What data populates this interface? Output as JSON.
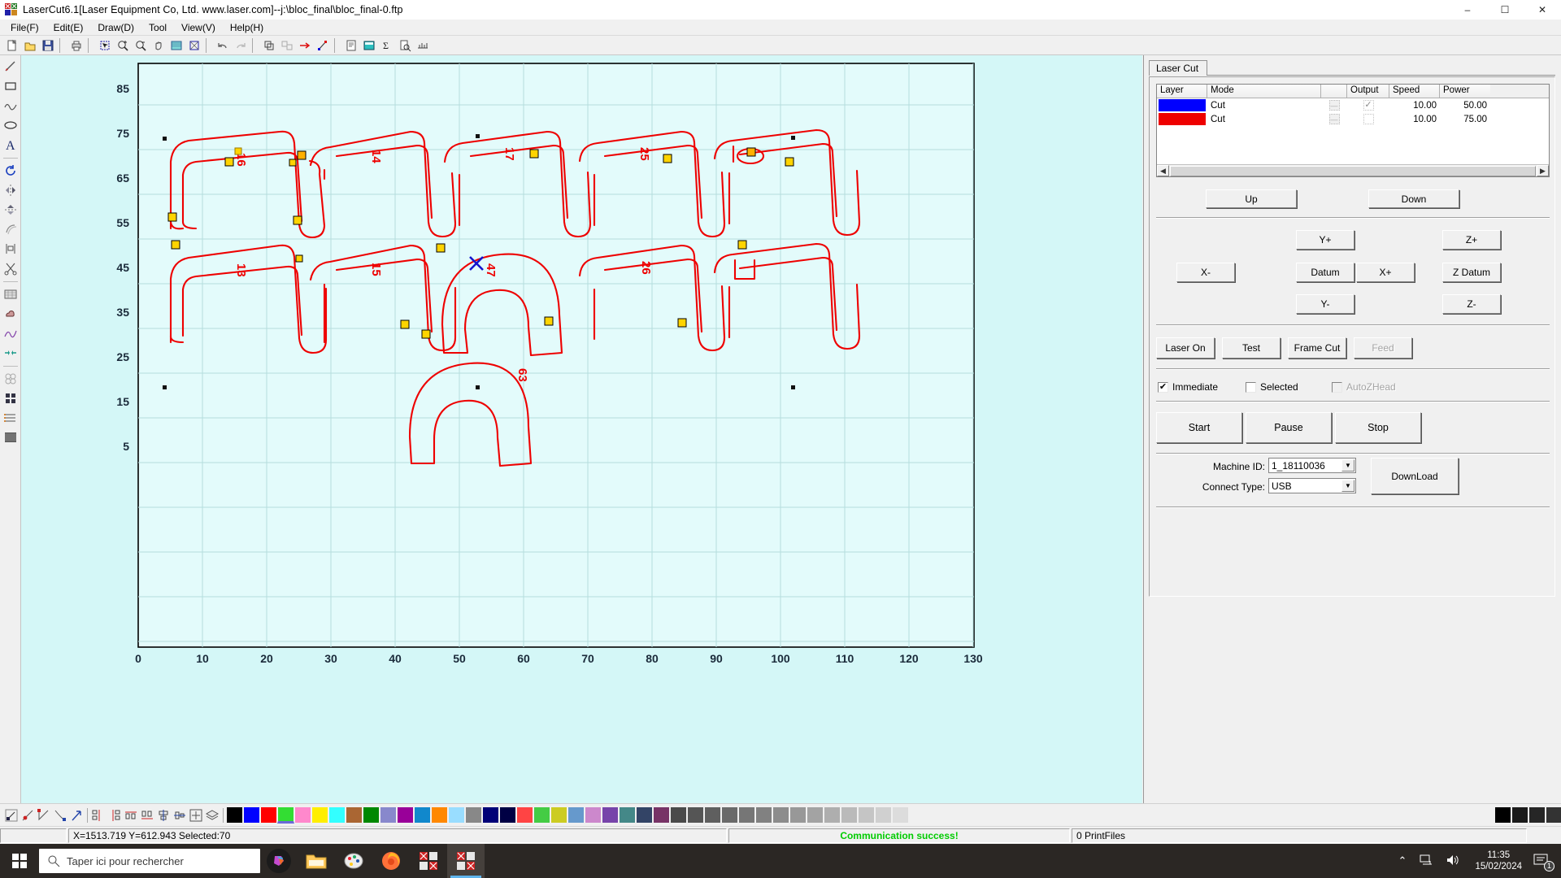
{
  "window": {
    "title": "LaserCut6.1[Laser Equipment Co, Ltd. www.laser.com]--j:\\bloc_final\\bloc_final-0.ftp",
    "app_icon": "lasercut-icon",
    "minimize": "–",
    "maximize": "☐",
    "close": "✕"
  },
  "menu": {
    "items": [
      {
        "label": "File(F)",
        "name": "menu-file"
      },
      {
        "label": "Edit(E)",
        "name": "menu-edit"
      },
      {
        "label": "Draw(D)",
        "name": "menu-draw"
      },
      {
        "label": "Tool",
        "name": "menu-tool"
      },
      {
        "label": "View(V)",
        "name": "menu-view"
      },
      {
        "label": "Help(H)",
        "name": "menu-help"
      }
    ]
  },
  "toolbar": {
    "buttons": [
      {
        "icon": "new-file-icon"
      },
      {
        "icon": "open-folder-icon"
      },
      {
        "icon": "save-icon"
      },
      {
        "icon": "print-icon"
      },
      {
        "icon": "select-zoom-icon"
      },
      {
        "icon": "zoom-in-icon"
      },
      {
        "icon": "zoom-out-icon"
      },
      {
        "icon": "pan-hand-icon"
      },
      {
        "icon": "fit-window-icon"
      },
      {
        "icon": "zoom-selection-icon"
      },
      {
        "icon": "undo-icon"
      },
      {
        "icon": "redo-icon"
      },
      {
        "icon": "group-icon"
      },
      {
        "icon": "ungroup-icon"
      },
      {
        "icon": "arrow-right-icon"
      },
      {
        "icon": "node-edit-icon"
      },
      {
        "icon": "properties-icon"
      },
      {
        "icon": "calculator-icon"
      },
      {
        "icon": "sum-icon"
      },
      {
        "icon": "preview-icon"
      },
      {
        "icon": "measure-icon"
      }
    ]
  },
  "left_tools": {
    "items": [
      {
        "icon": "pick-line-icon"
      },
      {
        "icon": "rectangle-icon"
      },
      {
        "icon": "polyline-icon"
      },
      {
        "icon": "ellipse-icon"
      },
      {
        "icon": "text-icon"
      },
      {
        "icon": "rotate-icon"
      },
      {
        "icon": "mirror-horizontal-icon"
      },
      {
        "icon": "mirror-vertical-icon"
      },
      {
        "icon": "offset-icon"
      },
      {
        "icon": "align-icon"
      },
      {
        "icon": "cut-scissors-icon"
      },
      {
        "icon": "array-icon"
      },
      {
        "icon": "cloud-icon"
      },
      {
        "icon": "curve-smooth-icon"
      },
      {
        "icon": "join-icon"
      },
      {
        "icon": "circles-icon"
      },
      {
        "icon": "grid-array-icon"
      },
      {
        "icon": "list-icon"
      },
      {
        "icon": "fill-pattern-icon"
      }
    ]
  },
  "canvas": {
    "x_axis": {
      "ticks": [
        0,
        10,
        20,
        30,
        40,
        50,
        60,
        70,
        80,
        90,
        100,
        110,
        120,
        130
      ]
    },
    "y_axis": {
      "ticks": [
        85,
        75,
        65,
        55,
        45,
        35,
        25,
        15,
        5
      ]
    },
    "background_color": "#d4f7f7",
    "grid_color": "#b9dede",
    "shape_color": "#ee0000",
    "node_color": "#ffd400",
    "cursor_marker": "blue-x-cursor",
    "part_labels": [
      "16",
      "14",
      "17",
      "25",
      "13",
      "15",
      "47",
      "26",
      "63"
    ]
  },
  "right_panel": {
    "tab": {
      "label": "Laser Cut",
      "name": "tab-laser-cut"
    },
    "layer_grid": {
      "columns": [
        "Layer",
        "Mode",
        "",
        "Output",
        "Speed",
        "Power"
      ],
      "rows": [
        {
          "color": "#0000ff",
          "mode": "Cut",
          "output": true,
          "speed": "10.00",
          "power": "50.00"
        },
        {
          "color": "#ee0000",
          "mode": "Cut",
          "output": false,
          "speed": "10.00",
          "power": "75.00"
        }
      ]
    },
    "order_buttons": {
      "up": "Up",
      "down": "Down"
    },
    "jog": {
      "y_plus": "Y+",
      "y_minus": "Y-",
      "x_plus": "X+",
      "x_minus": "X-",
      "datum": "Datum",
      "z_plus": "Z+",
      "z_minus": "Z-",
      "z_datum": "Z Datum"
    },
    "actions": {
      "laser_on": "Laser On",
      "test": "Test",
      "frame_cut": "Frame Cut",
      "feed": "Feed"
    },
    "options": {
      "immediate": {
        "label": "Immediate",
        "checked": true,
        "enabled": true
      },
      "selected": {
        "label": "Selected",
        "checked": false,
        "enabled": true
      },
      "auto_z_head": {
        "label": "AutoZHead",
        "checked": false,
        "enabled": false
      }
    },
    "run": {
      "start": "Start",
      "pause": "Pause",
      "stop": "Stop"
    },
    "device": {
      "machine_id_label": "Machine ID:",
      "machine_id_value": "1_18110036",
      "connect_type_label": "Connect Type:",
      "connect_type_value": "USB",
      "download": "DownLoad"
    }
  },
  "bottom_toolbar": {
    "buttons": [
      {
        "icon": "node-select-icon"
      },
      {
        "icon": "node-add-icon"
      },
      {
        "icon": "node-delete-icon"
      },
      {
        "icon": "node-break-icon"
      },
      {
        "icon": "node-move-icon"
      },
      {
        "icon": "align-left-icon"
      },
      {
        "icon": "align-right-icon"
      },
      {
        "icon": "align-top-icon"
      },
      {
        "icon": "align-bottom-icon"
      },
      {
        "icon": "align-center-h-icon"
      },
      {
        "icon": "align-center-v-icon"
      },
      {
        "icon": "distribute-icon"
      },
      {
        "icon": "layers-icon"
      }
    ],
    "palette": [
      "#000000",
      "#0000ff",
      "#ff0000",
      "#33dd33",
      "#ff88cc",
      "#ffee00",
      "#33ffff",
      "#aa6633",
      "#008800",
      "#8888cc",
      "#990099",
      "#1188cc",
      "#ff8800",
      "#99ddff",
      "#888888",
      "#000077",
      "#000044",
      "#ff4444",
      "#44cc44",
      "#cccc22",
      "#6699cc",
      "#cc88cc",
      "#7744aa",
      "#448888",
      "#334466",
      "#773366",
      "#4a4a4a",
      "#555555",
      "#5f5f5f",
      "#6a6a6a",
      "#767676",
      "#818181",
      "#8c8c8c",
      "#989898",
      "#a3a3a3",
      "#aeaeae",
      "#bababa",
      "#c5c5c5",
      "#d0d0d0",
      "#dcdcdc"
    ],
    "palette_selected_index": 3,
    "right_palette": [
      "#000000",
      "#1a1a1a",
      "#262626",
      "#333333",
      "#404040",
      "#4d4d4d",
      "#595959"
    ]
  },
  "status_bar": {
    "coords": "X=1513.719 Y=612.943 Selected:70",
    "message": "Communication success!",
    "message_color": "#00cc00",
    "print_files": "0 PrintFiles"
  },
  "taskbar": {
    "start": "start-icon",
    "search_placeholder": "Taper ici pour rechercher",
    "icons": [
      {
        "name": "cortana-icon"
      },
      {
        "name": "file-explorer-icon"
      },
      {
        "name": "paint-icon"
      },
      {
        "name": "firefox-icon"
      },
      {
        "name": "lasercut-taskbar-icon"
      },
      {
        "name": "lasercut-taskbar-icon-active"
      }
    ],
    "tray": {
      "chevron": "⌃",
      "network": "network-icon",
      "volume": "volume-icon",
      "time": "11:35",
      "date": "15/02/2024",
      "notifications": "notification-icon",
      "badge": "1"
    }
  }
}
